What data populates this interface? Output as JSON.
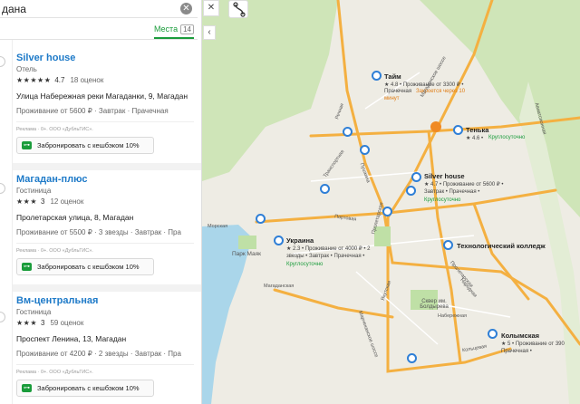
{
  "search": {
    "value": "дана"
  },
  "tabs": {
    "places_label": "Места",
    "places_count": "14"
  },
  "cards": [
    {
      "name": "Silver house",
      "type": "Отель",
      "stars": "★★★★★",
      "rating": "4.7",
      "reviews": "18 оценок",
      "address": "Улица Набережная реки Магаданки, 9, Магадан",
      "details": "Проживание от 5600 ₽ · Завтрак · Прачечная",
      "ad": "Реклама · 0+. ООО «ДубльГИС».",
      "book": "Забронировать с кешбэком 10%"
    },
    {
      "name": "Магадан-плюс",
      "type": "Гостиница",
      "stars": "★★★",
      "rating": "3",
      "reviews": "12 оценок",
      "address": "Пролетарская улица, 8, Магадан",
      "details": "Проживание от 5500 ₽ · 3 звезды · Завтрак · Пра",
      "ad": "Реклама · 0+. ООО «ДубльГИС».",
      "book": "Забронировать с кешбэком 10%"
    },
    {
      "name": "Вм-центральная",
      "type": "Гостиница",
      "stars": "★★★",
      "rating": "3",
      "reviews": "59 оценок",
      "address": "Проспект Ленина, 13, Магадан",
      "details": "Проживание от 4200 ₽ · 2 звезды · Завтрак · Пра",
      "ad": "Реклама · 0+. ООО «ДубльГИС».",
      "book": "Забронировать с кешбэком 10%"
    }
  ],
  "map": {
    "places": {
      "taim": {
        "name": "Тайм",
        "line1": "★ 4.8 • Проживание от 3300 ₽ •",
        "line2": "Прачечная",
        "warn": "Закроется через 10",
        "warn2": "минут"
      },
      "tenka": {
        "name": "Тенька",
        "line1": "★ 4.6 •",
        "status": "Круглосуточно"
      },
      "silver": {
        "name": "Silver house",
        "line1": "★ 4.7 • Проживание от 5600 ₽ •",
        "line2": "Завтрак • Прачечная •",
        "status": "Круглосуточно"
      },
      "ukraina": {
        "name": "Украина",
        "line1": "★ 2.3 • Проживание от 4000 ₽ • 2",
        "line2": "звезды • Завтрак • Прачечная •",
        "status": "Круглосуточно"
      },
      "tech": {
        "name": "Технологический колледж"
      },
      "kolym": {
        "name": "Колымская",
        "line1": "★ 5 • Проживание от 390",
        "line2": "Прачечная •"
      }
    },
    "streets": {
      "rechnaya": "Речная",
      "transportnaya": "Транспортная",
      "pushkina": "Пушкина",
      "portovaya": "Портовая",
      "proletarskaya": "Пролетарская",
      "morskaya": "Морская",
      "magadanskaya": "Магаданская",
      "yakutskaya": "Якутская",
      "proletarskaya2": "Пролетарская",
      "marchekanskoe": "Марчеканское шоссе",
      "naberezhnaya": "Набережная",
      "narodnaya": "Народная",
      "kolceva": "Кольцевая",
      "magadanskaya_tr": "Магаданское шоссе",
      "aviatsionnaya": "Авиатсионная"
    },
    "landmarks": {
      "park": "Парк Маяк",
      "square": "Сквер им. Болдырева"
    }
  },
  "colors": {
    "accent": "#1a9c3b",
    "link": "#1e7ac8",
    "road": "#f4b041",
    "pin": "#2f7fd6",
    "water": "#aad6ea",
    "forest": "#cfe5b8"
  }
}
